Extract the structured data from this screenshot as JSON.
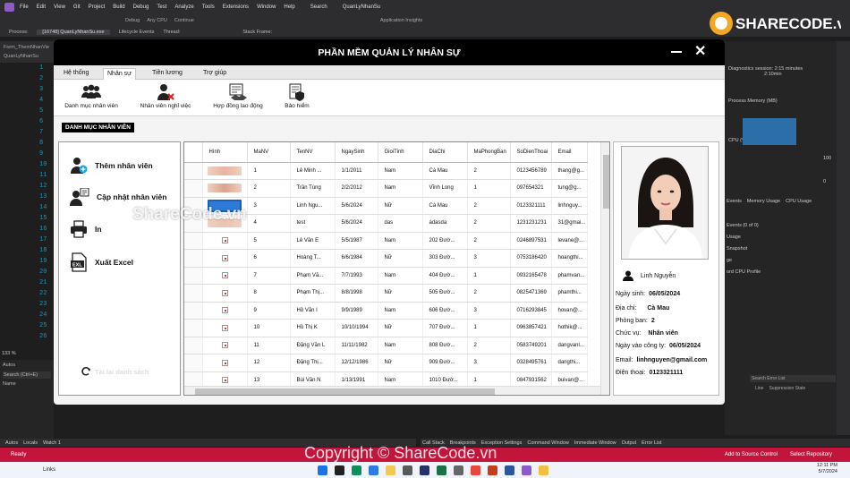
{
  "vs": {
    "menu": [
      "File",
      "Edit",
      "View",
      "Git",
      "Project",
      "Build",
      "Debug",
      "Test",
      "Analyze",
      "Tools",
      "Extensions",
      "Window",
      "Help"
    ],
    "search": "Search",
    "solution": "QuanLyNhanSu",
    "toolbar": [
      "Debug",
      "Any CPU",
      "Continue",
      "Application Insights"
    ],
    "process_label": "Process:",
    "process_value": "[16748] QuanLyNhanSu.exe",
    "lifecycle": "Lifecycle Events",
    "thread": "Thread:",
    "stack_frame": "Stack Frame:",
    "doc_tab": "Form_ThemNhanVie",
    "doc_tab2": "QuanLyNhanSu",
    "line_numbers": [
      "1",
      "2",
      "3",
      "4",
      "5",
      "6",
      "7",
      "8",
      "9",
      "10",
      "11",
      "12",
      "13",
      "14",
      "15",
      "16",
      "17",
      "18",
      "19",
      "20",
      "21",
      "22",
      "23",
      "24",
      "25",
      "26"
    ],
    "zoom": "133 %",
    "autos_title": "Autos",
    "autos_search": "Search (Ctrl+E)",
    "autos_col": "Name",
    "bottom_tabs_left": [
      "Autos",
      "Locals",
      "Watch 1"
    ],
    "bottom_tabs_right": [
      "Call Stack",
      "Breakpoints",
      "Exception Settings",
      "Command Window",
      "Immediate Window",
      "Output",
      "Error List"
    ],
    "diag_session": "Diagnostics session: 2:15 minutes",
    "diag_time": "2:10min",
    "diag_memory": "Process Memory (MB)",
    "diag_cpu": "CPU (% of all processors)",
    "diag_val_100": "100",
    "diag_val_0": "0",
    "diag_tabs": [
      "Events",
      "Memory Usage",
      "CPU Usage"
    ],
    "diag_items": [
      "Events (0 of 0)",
      "Usage",
      "Snapshot",
      "ge",
      "ord CPU Profile"
    ],
    "error_search": "Search Error List",
    "error_cols": [
      "Line",
      "Suppression State"
    ],
    "status_ready": "Ready",
    "status_add_source": "Add to Source Control",
    "status_repo": "Select Repository",
    "status_links": "Links",
    "clock_time": "12:11 PM",
    "clock_date": "5/7/2024",
    "watermark": "Copyright © ShareCode.vn",
    "logo_text": "SHARECODE.vn"
  },
  "app": {
    "title": "PHẦN MỀM QUẢN LÝ NHÂN SỰ",
    "tabs": [
      "Hệ thống",
      "Nhân sự",
      "Tiền lương",
      "Trợ giúp"
    ],
    "active_tab": "Nhân sự",
    "ribbon": [
      "Danh mục nhân viên",
      "Nhân viên nghỉ việc",
      "Hợp đồng lao động",
      "Bảo hiểm"
    ],
    "section": "DANH MỤC NHÂN VIÊN",
    "watermark": "ShareCode.vn",
    "left_buttons": [
      "Thêm nhân viên",
      "Cập nhật nhân viên",
      "In",
      "Xuất Excel"
    ],
    "reload": "Tải lại danh sách",
    "columns": [
      "Hình",
      "MaNV",
      "TenNV",
      "NgaySinh",
      "GioiTinh",
      "DiaChi",
      "MaPhongBan",
      "SoDienThoai",
      "Email"
    ],
    "rows": [
      [
        "photo",
        "1",
        "Lê Minh ...",
        "1/1/2011",
        "Nam",
        "Cà Mau",
        "2",
        "0123456789",
        "thang@g..."
      ],
      [
        "photo",
        "2",
        "Trần Tùng",
        "2/2/2012",
        "Nam",
        "Vĩnh Long",
        "1",
        "097654321",
        "tung@g..."
      ],
      [
        "photo-sel",
        "3",
        "Linh Ngu...",
        "5/6/2024",
        "Nữ",
        "Cà Mau",
        "2",
        "0123321111",
        "linhnguy..."
      ],
      [
        "photo",
        "4",
        "test",
        "5/6/2024",
        "das",
        "ádasda",
        "2",
        "1231231231",
        "31@gmai..."
      ],
      [
        "broken",
        "5",
        "Lê Văn E",
        "5/5/1987",
        "Nam",
        "202 Đườ...",
        "2",
        "0246897531",
        "levane@..."
      ],
      [
        "broken",
        "6",
        "Hoàng T...",
        "6/6/1984",
        "Nữ",
        "303 Đườ...",
        "3",
        "0753186420",
        "hoangthi..."
      ],
      [
        "broken",
        "7",
        "Phạm Vă...",
        "7/7/1993",
        "Nam",
        "404 Đườ...",
        "1",
        "0932165478",
        "phamvan..."
      ],
      [
        "broken",
        "8",
        "Phạm Thị...",
        "8/8/1998",
        "Nữ",
        "505 Đườ...",
        "2",
        "0825471369",
        "phamthi..."
      ],
      [
        "broken",
        "9",
        "Hồ Văn I",
        "9/9/1989",
        "Nam",
        "606 Đườ...",
        "3",
        "0716293845",
        "hovan@..."
      ],
      [
        "broken",
        "10",
        "Hồ Thị K",
        "10/10/1994",
        "Nữ",
        "707 Đườ...",
        "1",
        "0963857421",
        "hothik@..."
      ],
      [
        "broken",
        "11",
        "Đặng Văn L",
        "11/11/1982",
        "Nam",
        "808 Đườ...",
        "2",
        "0583749201",
        "dangvanl..."
      ],
      [
        "broken",
        "12",
        "Đặng Thị...",
        "12/12/1986",
        "Nữ",
        "909 Đườ...",
        "3",
        "0328495761",
        "dangthi..."
      ],
      [
        "broken",
        "13",
        "Bùi Văn N",
        "1/13/1991",
        "Nam",
        "1010 Đườ...",
        "1",
        "0847931562",
        "buivan@..."
      ]
    ],
    "detail": {
      "name": "Linh Nguyễn",
      "dob_label": "Ngày sinh:",
      "dob": "06/05/2024",
      "address_label": "Địa chỉ:",
      "address": "Cà Mau",
      "dept_label": "Phòng ban:",
      "dept": "2",
      "role_label": "Chức vụ:",
      "role": "Nhân viên",
      "start_label": "Ngày vào công ty:",
      "start": "06/05/2024",
      "email_label": "Email:",
      "email": "linhnguyen@gmail.com",
      "phone_label": "Điện thoại:",
      "phone": "0123321111"
    }
  }
}
